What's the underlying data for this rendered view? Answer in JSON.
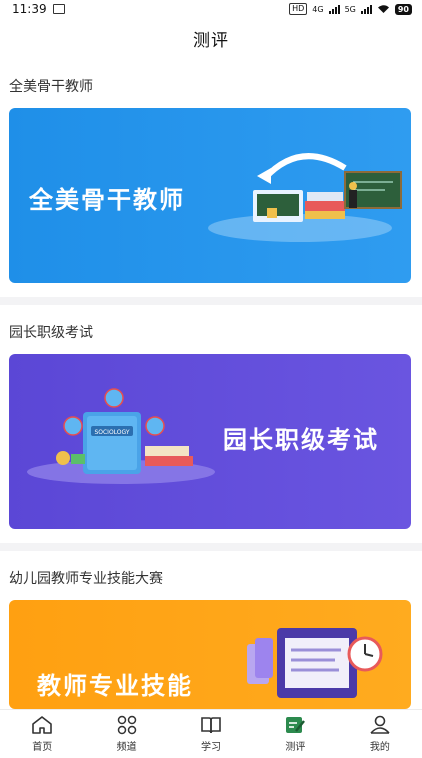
{
  "status_bar": {
    "time": "11:39",
    "network_1": "HD",
    "network_2": "4G",
    "network_3": "5G",
    "battery": "90"
  },
  "header": {
    "title": "测评"
  },
  "sections": [
    {
      "label": "全美骨干教师",
      "banner_text": "全美骨干教师"
    },
    {
      "label": "园长职级考试",
      "banner_text": "园长职级考试"
    },
    {
      "label": "幼儿园教师专业技能大赛",
      "banner_text": "教师专业技能"
    }
  ],
  "illustrations": {
    "book_label": "SOCIOLOGY"
  },
  "tabbar": {
    "items": [
      {
        "label": "首页",
        "icon": "home-icon"
      },
      {
        "label": "频道",
        "icon": "channel-grid-icon"
      },
      {
        "label": "学习",
        "icon": "book-icon"
      },
      {
        "label": "测评",
        "icon": "assessment-icon"
      },
      {
        "label": "我的",
        "icon": "profile-icon"
      }
    ],
    "active_index": 3
  },
  "colors": {
    "card_blue": "#2f9cf0",
    "card_purple": "#6a55e0",
    "card_orange": "#ffab1f",
    "active_tab": "#2c8a4e"
  }
}
